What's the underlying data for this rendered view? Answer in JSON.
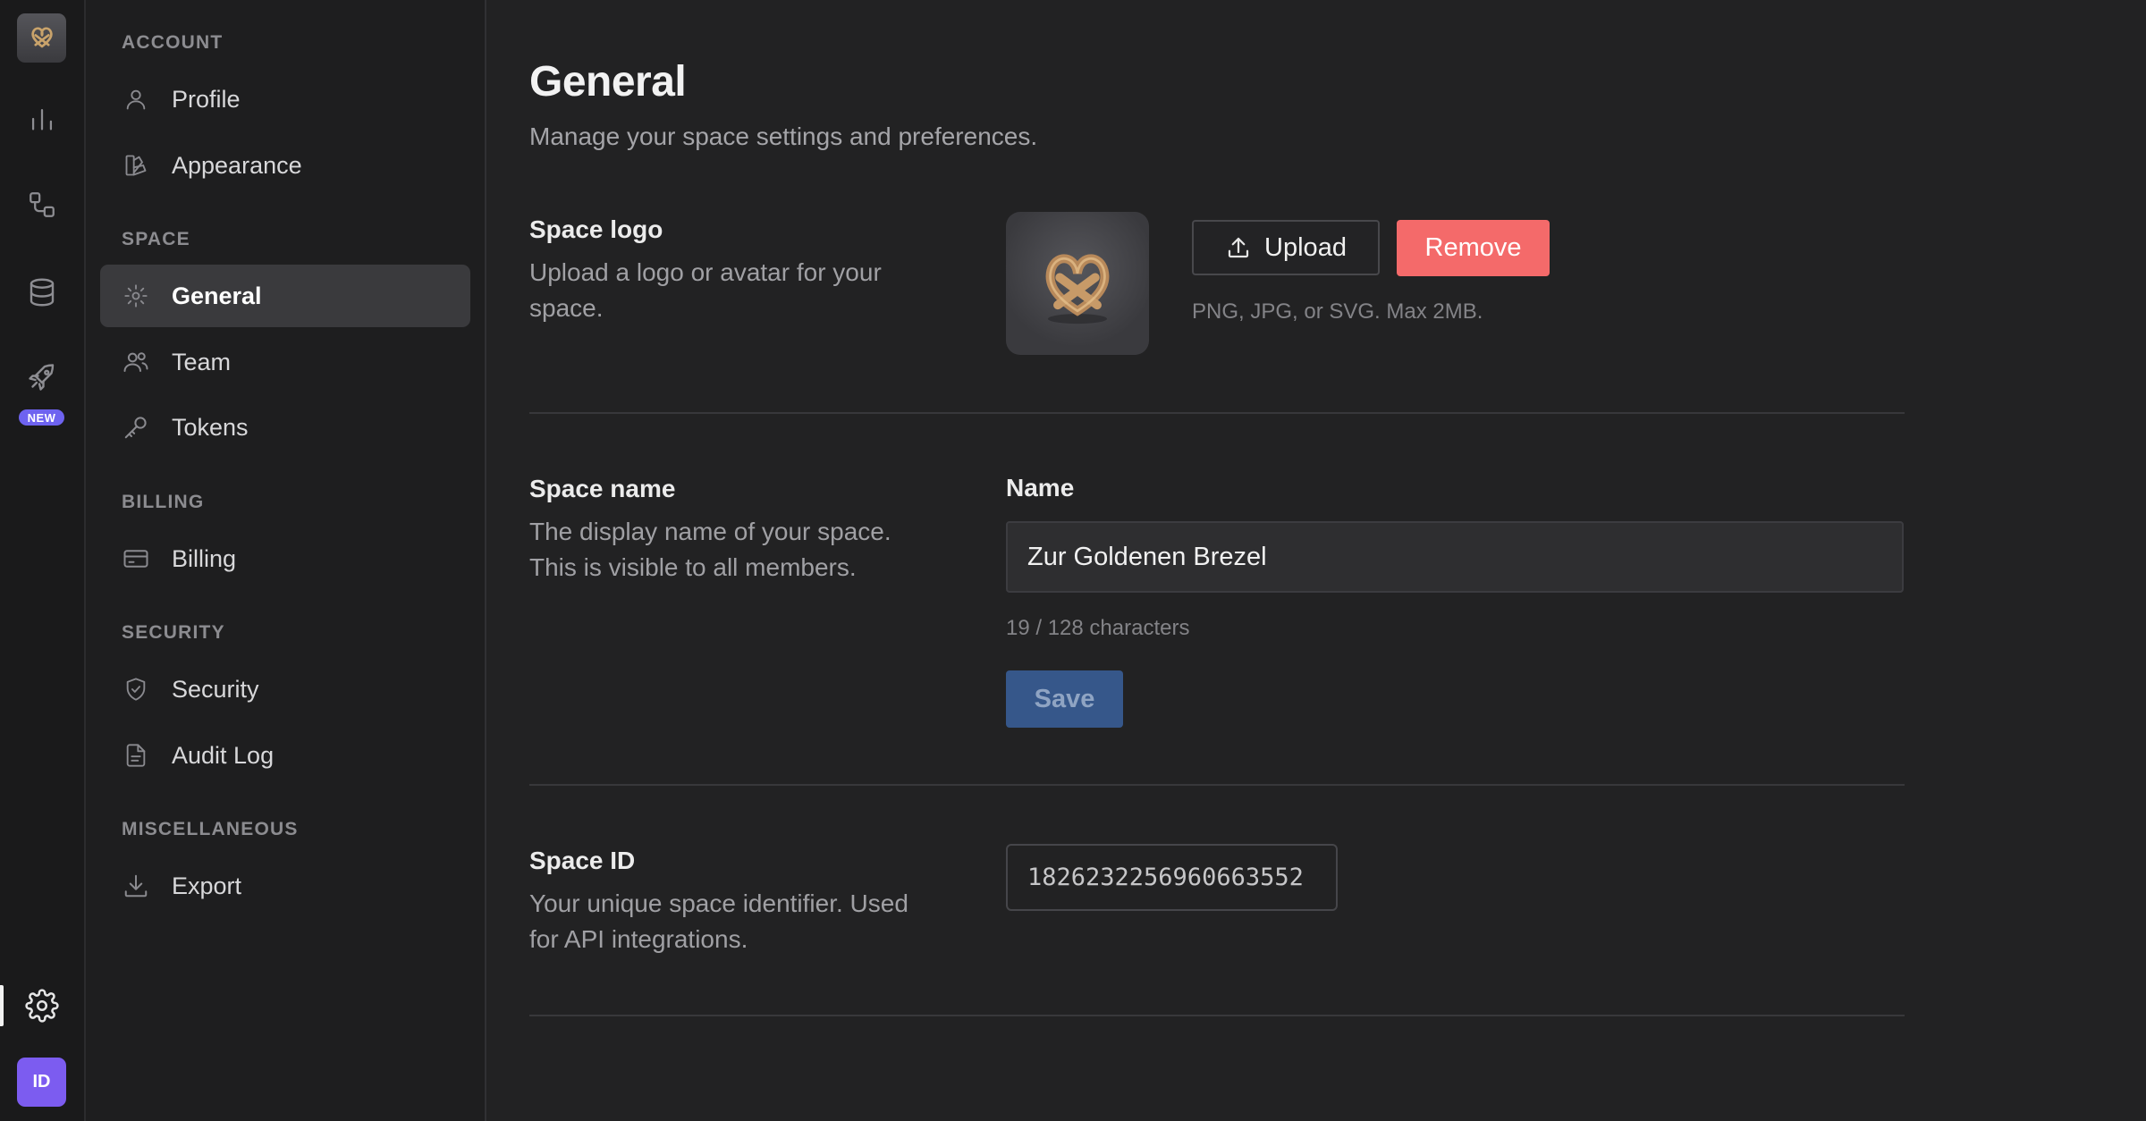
{
  "rail": {
    "new_badge": "NEW",
    "avatar_initials": "ID",
    "items": [
      "analytics-icon",
      "integrations-icon",
      "database-icon",
      "rocket-icon",
      "settings-icon"
    ]
  },
  "nav": {
    "sections": [
      {
        "title": "ACCOUNT",
        "items": [
          {
            "label": "Profile",
            "icon": "user-icon"
          },
          {
            "label": "Appearance",
            "icon": "palette-icon"
          }
        ]
      },
      {
        "title": "SPACE",
        "items": [
          {
            "label": "General",
            "icon": "gear-icon"
          },
          {
            "label": "Team",
            "icon": "users-icon"
          },
          {
            "label": "Tokens",
            "icon": "key-icon"
          }
        ]
      },
      {
        "title": "BILLING",
        "items": [
          {
            "label": "Billing",
            "icon": "credit-card-icon"
          }
        ]
      },
      {
        "title": "SECURITY",
        "items": [
          {
            "label": "Security",
            "icon": "shield-icon"
          },
          {
            "label": "Audit Log",
            "icon": "document-icon"
          }
        ]
      },
      {
        "title": "MISCELLANEOUS",
        "items": [
          {
            "label": "Export",
            "icon": "download-icon"
          }
        ]
      }
    ],
    "active": "General"
  },
  "page": {
    "title": "General",
    "subtitle": "Manage your space settings and preferences."
  },
  "logo_section": {
    "title": "Space logo",
    "description": "Upload a logo or avatar for your space.",
    "upload_label": "Upload",
    "remove_label": "Remove",
    "hint": "PNG, JPG, or SVG. Max 2MB."
  },
  "name_section": {
    "title": "Space name",
    "description": "The display name of your space. This is visible to all members.",
    "field_label": "Name",
    "value": "Zur Goldenen Brezel",
    "char_count": "19 / 128 characters",
    "save_label": "Save"
  },
  "id_section": {
    "title": "Space ID",
    "description": "Your unique space identifier. Used for API integrations.",
    "value": "1826232256960663552"
  },
  "colors": {
    "remove_button": "#f46a6a",
    "save_button": "#36578a",
    "new_badge": "#6e63f0",
    "avatar": "#7c5cf0"
  }
}
